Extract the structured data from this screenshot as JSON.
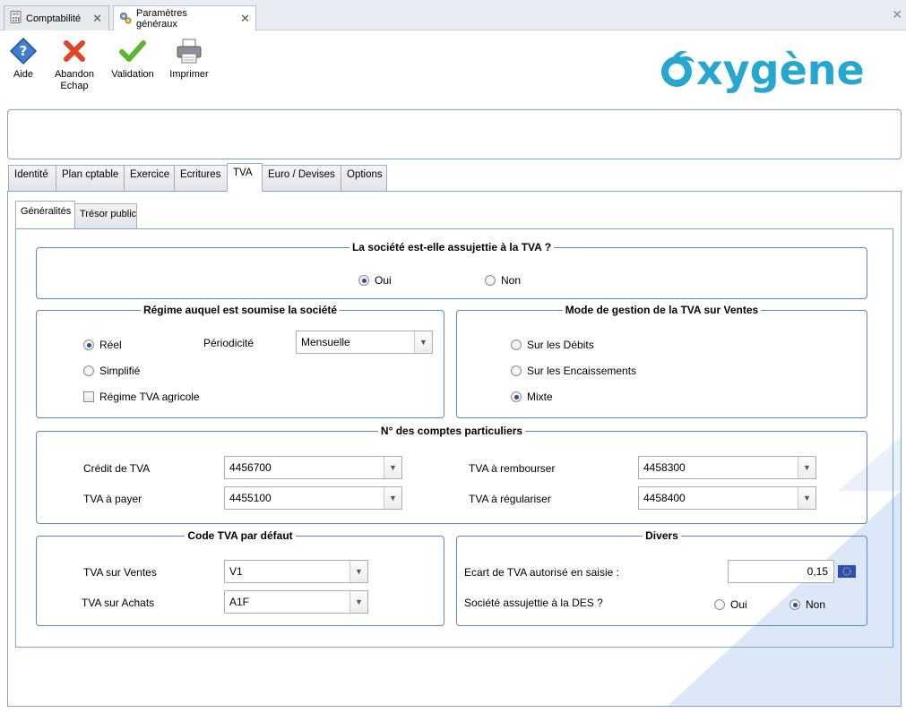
{
  "doc_tabs": [
    {
      "label": "Comptabilité",
      "icon": "calculator-icon"
    },
    {
      "label": "Paramètres généraux",
      "icon": "gears-icon"
    }
  ],
  "toolbar": {
    "help": "Aide",
    "cancel_line1": "Abandon",
    "cancel_line2": "Echap",
    "validate": "Validation",
    "print": "Imprimer"
  },
  "brand": {
    "name": "oxygène",
    "color": "#27a7cf"
  },
  "main_tabs": [
    "Identité",
    "Plan cptable",
    "Exercice",
    "Ecritures",
    "TVA",
    "Euro / Devises",
    "Options"
  ],
  "active_main_tab": "TVA",
  "sub_tabs": [
    "Généralités",
    "Trésor public"
  ],
  "active_sub_tab": "Généralités",
  "assujetti": {
    "title": "La société est-elle assujettie à la TVA ?",
    "oui": "Oui",
    "non": "Non",
    "selected": "Oui"
  },
  "regime": {
    "title": "Régime auquel est soumise la société",
    "reel": "Réel",
    "simplifie": "Simplifié",
    "agricole": "Régime TVA agricole",
    "agricole_checked": false,
    "selected": "Réel",
    "periodicite_label": "Périodicité",
    "periodicite_value": "Mensuelle"
  },
  "mode_gestion": {
    "title": "Mode de gestion de la TVA sur Ventes",
    "debits": "Sur les Débits",
    "encaissements": "Sur les Encaissements",
    "mixte": "Mixte",
    "selected": "Mixte"
  },
  "comptes": {
    "title": "N° des comptes particuliers",
    "credit_label": "Crédit de TVA",
    "credit_value": "4456700",
    "payer_label": "TVA à payer",
    "payer_value": "4455100",
    "rembourser_label": "TVA à rembourser",
    "rembourser_value": "4458300",
    "regulariser_label": "TVA à régulariser",
    "regulariser_value": "4458400"
  },
  "code_tva": {
    "title": "Code TVA par défaut",
    "ventes_label": "TVA sur Ventes",
    "ventes_value": "V1",
    "achats_label": "TVA sur Achats",
    "achats_value": "A1F"
  },
  "divers": {
    "title": "Divers",
    "ecart_label": "Ecart de TVA autorisé en saisie :",
    "ecart_value": "0,15",
    "des_label": "Société assujettie à la DES ?",
    "oui": "Oui",
    "non": "Non",
    "selected": "Non"
  },
  "colors": {
    "frame_border": "#5d86c2",
    "deco": "#dce7f7"
  }
}
